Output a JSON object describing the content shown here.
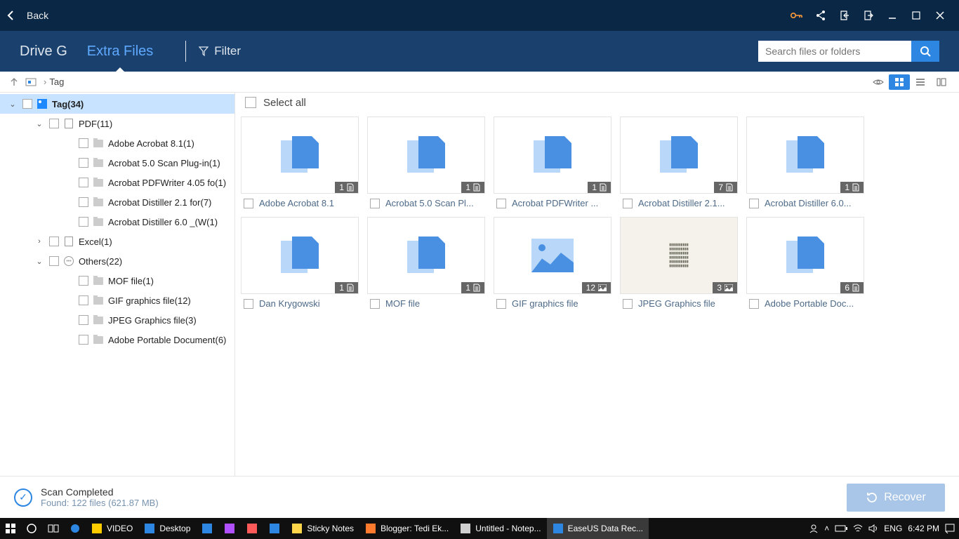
{
  "titlebar": {
    "back": "Back"
  },
  "tabs": {
    "drive": "Drive G",
    "extra": "Extra Files",
    "filter": "Filter"
  },
  "search": {
    "placeholder": "Search files or folders"
  },
  "breadcrumb": {
    "label": "Tag"
  },
  "tree": {
    "root": "Tag(34)",
    "pdf": {
      "label": "PDF(11)",
      "items": [
        "Adobe Acrobat 8.1(1)",
        "Acrobat 5.0 Scan Plug-in(1)",
        "Acrobat PDFWriter 4.05 fo(1)",
        "Acrobat Distiller 2.1 for(7)",
        "Acrobat Distiller 6.0 _(W(1)"
      ]
    },
    "excel": "Excel(1)",
    "others": {
      "label": "Others(22)",
      "items": [
        "MOF file(1)",
        "GIF graphics file(12)",
        "JPEG Graphics file(3)",
        "Adobe Portable Document(6)"
      ]
    }
  },
  "selectall": "Select all",
  "tiles": [
    {
      "label": "Adobe Acrobat 8.1",
      "count": "1",
      "type": "doc"
    },
    {
      "label": "Acrobat 5.0 Scan Pl...",
      "count": "1",
      "type": "doc"
    },
    {
      "label": "Acrobat PDFWriter ...",
      "count": "1",
      "type": "doc"
    },
    {
      "label": "Acrobat Distiller 2.1...",
      "count": "7",
      "type": "doc"
    },
    {
      "label": "Acrobat Distiller 6.0...",
      "count": "1",
      "type": "doc"
    },
    {
      "label": "Dan Krygowski",
      "count": "1",
      "type": "doc"
    },
    {
      "label": "MOF file",
      "count": "1",
      "type": "doc"
    },
    {
      "label": "GIF graphics file",
      "count": "12",
      "type": "img"
    },
    {
      "label": "JPEG Graphics file",
      "count": "3",
      "type": "jpeg"
    },
    {
      "label": "Adobe Portable Doc...",
      "count": "6",
      "type": "doc"
    }
  ],
  "footer": {
    "title": "Scan Completed",
    "sub": "Found: 122 files (621.87 MB)",
    "recover": "Recover"
  },
  "taskbar": {
    "items": [
      {
        "label": "VIDEO",
        "color": "#ffcc00"
      },
      {
        "label": "Desktop",
        "color": "#2d87e2"
      },
      {
        "label": "",
        "color": "#2d87e2"
      },
      {
        "label": "",
        "color": "#b050ff"
      },
      {
        "label": "",
        "color": "#ff5a5a"
      },
      {
        "label": "",
        "color": "#2d87e2"
      },
      {
        "label": "Sticky Notes",
        "color": "#ffd54a"
      },
      {
        "label": "Blogger: Tedi Ek...",
        "color": "#ff7a2d"
      },
      {
        "label": "Untitled - Notep...",
        "color": "#d0d0d0"
      },
      {
        "label": "EaseUS Data Rec...",
        "color": "#2d87e2",
        "active": true
      }
    ],
    "lang": "ENG",
    "time": "6:42 PM"
  }
}
